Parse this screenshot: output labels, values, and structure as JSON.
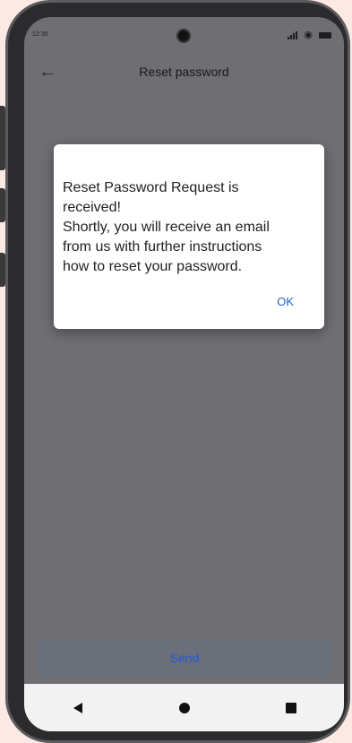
{
  "status_bar": {
    "time": "12:30",
    "icons": [
      "signal-icon",
      "wifi-icon",
      "battery-icon"
    ]
  },
  "app_bar": {
    "back_icon": "arrow-left-icon",
    "title": "Reset password"
  },
  "dialog": {
    "message": "Reset Password Request is\nreceived!\nShortly, you will receive an email\nfrom us with further instructions\nhow to reset your password.",
    "ok_label": "OK",
    "ok_color": "#1e64c8"
  },
  "send_button": {
    "label": "Send",
    "color": "#1f5bd4"
  },
  "nav_bar": {
    "buttons": [
      "back-triangle-icon",
      "home-circle-icon",
      "recents-square-icon"
    ]
  }
}
